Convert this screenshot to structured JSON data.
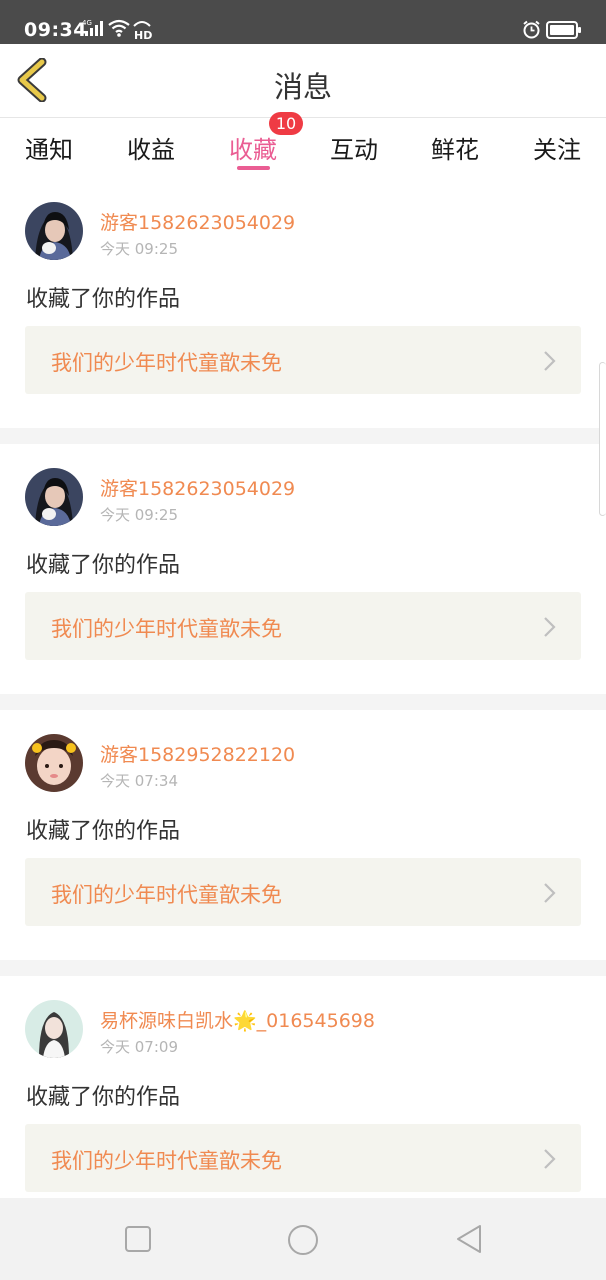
{
  "status_bar": {
    "time": "09:34",
    "network": "4G",
    "hd": "HD"
  },
  "header": {
    "title": "消息"
  },
  "tabs": [
    {
      "label": "通知",
      "active": false
    },
    {
      "label": "收益",
      "active": false
    },
    {
      "label": "收藏",
      "active": true,
      "badge": "10"
    },
    {
      "label": "互动",
      "active": false
    },
    {
      "label": "鲜花",
      "active": false
    },
    {
      "label": "关注",
      "active": false
    }
  ],
  "messages": [
    {
      "username": "游客1582623054029",
      "time": "今天 09:25",
      "action": "收藏了你的作品",
      "work_title": "我们的少年时代童歆未免"
    },
    {
      "username": "游客1582623054029",
      "time": "今天 09:25",
      "action": "收藏了你的作品",
      "work_title": "我们的少年时代童歆未免"
    },
    {
      "username": "游客1582952822120",
      "time": "今天 07:34",
      "action": "收藏了你的作品",
      "work_title": "我们的少年时代童歆未免"
    },
    {
      "username": "易杯源味白凯水🌟_016545698",
      "time": "今天 07:09",
      "action": "收藏了你的作品",
      "work_title": "我们的少年时代童歆未免"
    }
  ],
  "colors": {
    "accent": "#ea5d93",
    "username": "#f08a51",
    "badge": "#ef3b44",
    "back_arrow": "#e8c94a"
  }
}
